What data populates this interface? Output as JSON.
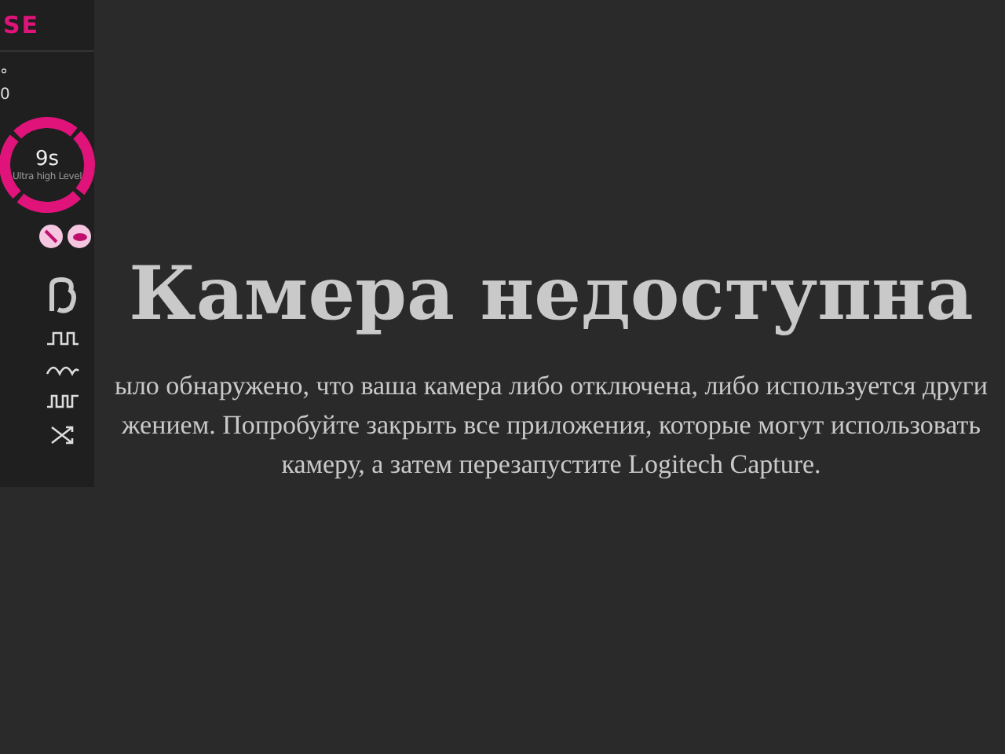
{
  "sidebar": {
    "logo": "SE",
    "stat_symbol": "°",
    "stat_value": "0",
    "dial": {
      "value": "9s",
      "caption": "Ultra high Level"
    },
    "toggles": [
      {
        "kind": "pen"
      },
      {
        "kind": "lips"
      }
    ],
    "tools": [
      {
        "kind": "glyph"
      },
      {
        "kind": "square"
      },
      {
        "kind": "wave"
      },
      {
        "kind": "pulse"
      },
      {
        "kind": "shuffle"
      }
    ]
  },
  "message": {
    "title": "Камера недоступна",
    "lines": [
      "ыло обнаружено, что ваша камера либо отключена, либо используется други",
      "жением. Попробуйте закрыть все приложения, которые могут использовать",
      "камеру, а затем перезапустите Logitech Capture."
    ]
  }
}
